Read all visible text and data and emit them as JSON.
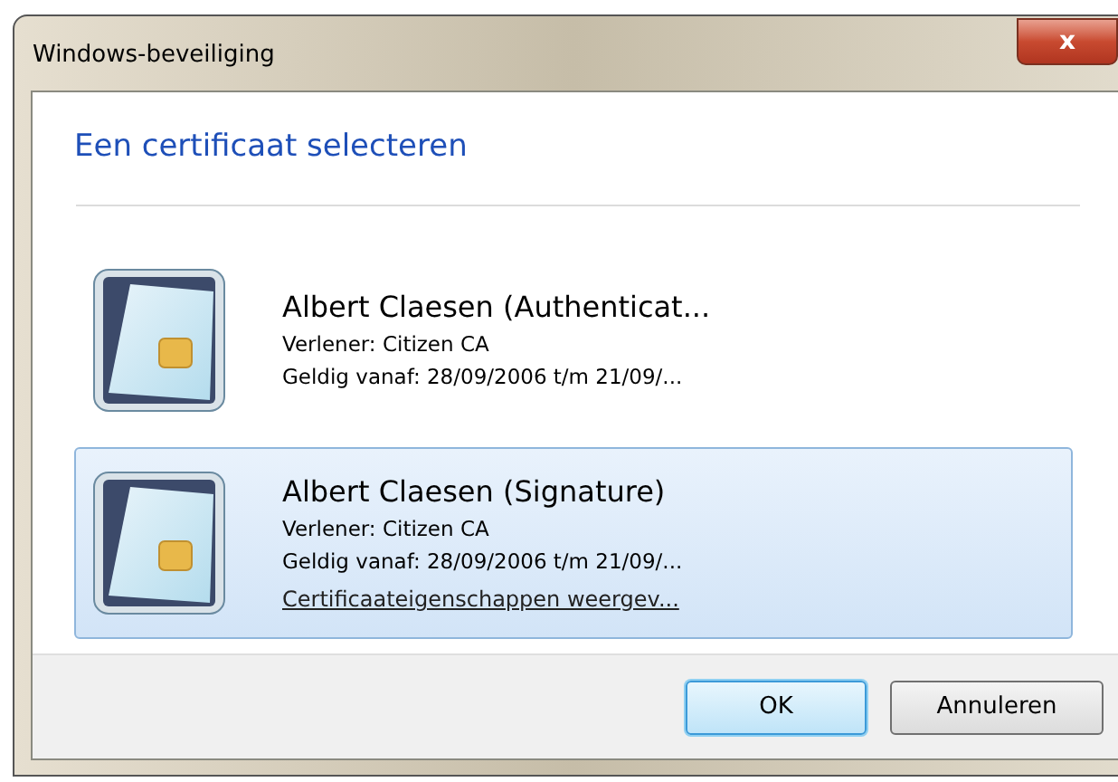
{
  "window": {
    "title": "Windows-beveiliging",
    "close": "x"
  },
  "heading": "Een certificaat selecteren",
  "certificates": [
    {
      "name": "Albert Claesen (Authenticat...",
      "issuer": "Verlener: Citizen CA",
      "validity": "Geldig vanaf: 28/09/2006 t/m 21/09/...",
      "selected": false
    },
    {
      "name": "Albert Claesen (Signature)",
      "issuer": "Verlener: Citizen CA",
      "validity": "Geldig vanaf: 28/09/2006 t/m 21/09/...",
      "link": "Certificaateigenschappen weergev...",
      "selected": true
    }
  ],
  "buttons": [
    {
      "label": "OK",
      "default": true
    },
    {
      "label": "Annuleren",
      "default": false
    }
  ]
}
